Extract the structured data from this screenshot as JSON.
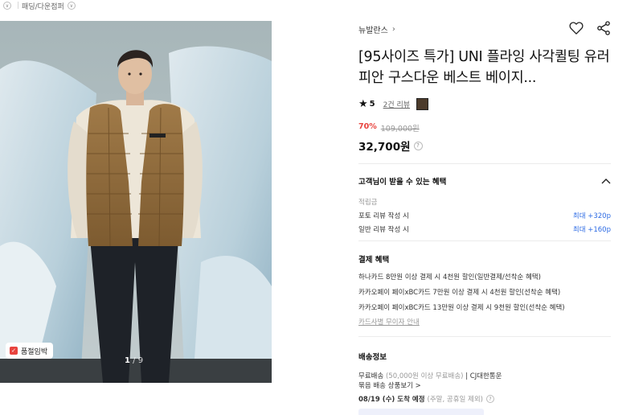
{
  "breadcrumb": {
    "label": "패딩/다운점퍼"
  },
  "gallery": {
    "badge": "품절임박",
    "pager_current": "1",
    "pager_separator": "/",
    "pager_total": "9"
  },
  "product": {
    "brand": "뉴발란스",
    "title": "[95사이즈 특가] UNI 플라잉 사각퀼팅 유러피안 구스다운 베스트 베이지...",
    "rating": "5",
    "review_count": "2건 리뷰",
    "discount_rate": "70%",
    "original_price": "109,000원",
    "price": "32,700원"
  },
  "benefits": {
    "header": "고객님이 받을 수 있는 혜택",
    "points_label": "적립금",
    "points": [
      {
        "label": "포토 리뷰 작성 시",
        "value": "최대 +320p"
      },
      {
        "label": "일반 리뷰 작성 시",
        "value": "최대 +160p"
      }
    ]
  },
  "payment": {
    "title": "결제 혜택",
    "lines": [
      "하나카드 8만원 이상 결제 시 4천원 할인(일반결제/선착순 혜택)",
      "카카오페이 페이xBC카드 7만원 이상 결제 시 4천원 할인(선착순 혜택)",
      "카카오페이 페이xBC카드 13만원 이상 결제 시 9천원 할인(선착순 혜택)"
    ],
    "installment_link": "카드사별 무이자 안내"
  },
  "shipping": {
    "title": "배송정보",
    "type": "무료배송",
    "condition": "(50,000원 이상 무료배송)",
    "carrier": "| CJ대한통운",
    "bundle": "묶음 배송 상품보기 >",
    "date": "08/19 (수) 도착 예정",
    "date_note": "(주말, 공휴일 제외)"
  },
  "colors": {
    "accent_red": "#e8433e",
    "point_blue": "#2d6be4"
  }
}
